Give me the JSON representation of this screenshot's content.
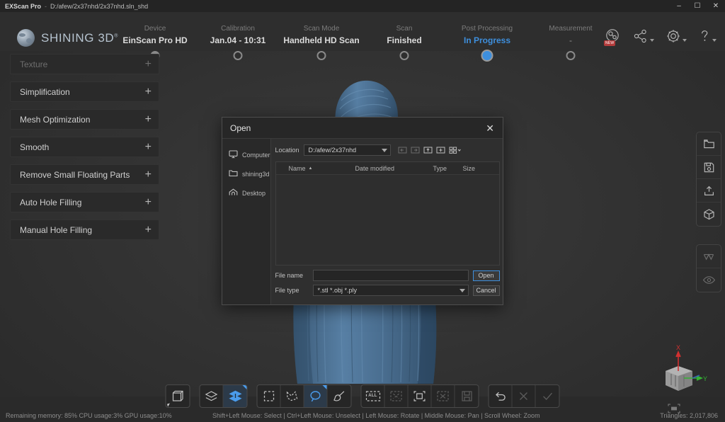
{
  "titlebar": {
    "app_name": "EXScan Pro",
    "separator": "-",
    "path": "D:/afew/2x37nhd/2x37nhd.sln_shd",
    "minimize": "–",
    "maximize": "☐",
    "close": "✕"
  },
  "brand": {
    "name": "SHINING 3D",
    "trademark": "®"
  },
  "steps": [
    {
      "caption": "Device",
      "value": "EinScan Pro HD",
      "state": "done"
    },
    {
      "caption": "Calibration",
      "value": "Jan.04 - 10:31",
      "state": "done"
    },
    {
      "caption": "Scan Mode",
      "value": "Handheld HD Scan",
      "state": "done"
    },
    {
      "caption": "Scan",
      "value": "Finished",
      "state": "done"
    },
    {
      "caption": "Post Processing",
      "value": "In Progress",
      "state": "current"
    },
    {
      "caption": "Measurement",
      "value": "-",
      "state": "pending"
    }
  ],
  "header_icons": [
    {
      "name": "model-library-icon",
      "badge": "NEW",
      "caret": false
    },
    {
      "name": "share-icon",
      "badge": "",
      "caret": true
    },
    {
      "name": "settings-gear-icon",
      "badge": "",
      "caret": true
    },
    {
      "name": "help-icon",
      "badge": "",
      "caret": true
    }
  ],
  "left_panel": [
    {
      "label": "Texture",
      "expand": "+",
      "disabled": true
    },
    {
      "label": "Simplification",
      "expand": "+",
      "disabled": false
    },
    {
      "label": "Mesh Optimization",
      "expand": "+",
      "disabled": false
    },
    {
      "label": "Smooth",
      "expand": "+",
      "disabled": false
    },
    {
      "label": "Remove Small Floating Parts",
      "expand": "+",
      "disabled": false
    },
    {
      "label": "Auto Hole Filling",
      "expand": "+",
      "disabled": false
    },
    {
      "label": "Manual Hole Filling",
      "expand": "+",
      "disabled": false
    }
  ],
  "right_tools": [
    {
      "name": "open-project-icon",
      "dim": false
    },
    {
      "name": "save-project-icon",
      "dim": false
    },
    {
      "name": "export-model-icon",
      "dim": false
    },
    {
      "name": "model-view-icon",
      "dim": false
    }
  ],
  "right_tools_2": [
    {
      "name": "wireframe-icon",
      "dim": true
    },
    {
      "name": "visibility-eye-icon",
      "dim": true
    }
  ],
  "bottom_toolbar": {
    "group1": [
      {
        "name": "bounding-box-icon",
        "state": "normal"
      }
    ],
    "group2": [
      {
        "name": "single-layer-icon",
        "state": "normal"
      },
      {
        "name": "multi-layer-icon",
        "state": "active"
      }
    ],
    "group3": [
      {
        "name": "rectangle-select-icon",
        "state": "normal"
      },
      {
        "name": "polygon-select-icon",
        "state": "normal"
      },
      {
        "name": "lasso-select-icon",
        "state": "active"
      },
      {
        "name": "brush-select-icon",
        "state": "normal"
      }
    ],
    "group4": [
      {
        "name": "select-all-icon",
        "state": "normal",
        "label": "ALL"
      },
      {
        "name": "invert-select-icon",
        "state": "dim",
        "label": ""
      },
      {
        "name": "select-visible-icon",
        "state": "normal",
        "label": ""
      },
      {
        "name": "delete-select-icon",
        "state": "dim",
        "label": ""
      },
      {
        "name": "save-select-icon",
        "state": "dim",
        "label": ""
      }
    ],
    "group5": [
      {
        "name": "undo-icon",
        "state": "normal"
      },
      {
        "name": "cancel-icon",
        "state": "dim"
      },
      {
        "name": "confirm-icon",
        "state": "dim"
      }
    ]
  },
  "gizmo": {
    "x_label": "X",
    "y_label": "Y",
    "x_color": "#d03030",
    "y_color": "#35b235"
  },
  "statusbar": {
    "resources": "Remaining memory: 85% CPU usage:3%  GPU usage:10%",
    "hints": "Shift+Left Mouse: Select | Ctrl+Left Mouse: Unselect | Left Mouse: Rotate | Middle Mouse: Pan | Scroll Wheel: Zoom",
    "triangles": "Triangles: 2,017,806"
  },
  "dialog": {
    "title": "Open",
    "close_glyph": "✕",
    "sidebar": [
      {
        "label": "Computer",
        "icon": "computer-icon"
      },
      {
        "label": "shining3d",
        "icon": "folder-icon"
      },
      {
        "label": "Desktop",
        "icon": "home-icon"
      }
    ],
    "location_label": "Location",
    "location_value": "D:/afew/2x37nhd",
    "nav_buttons": [
      {
        "name": "back-button",
        "dim": true
      },
      {
        "name": "forward-button",
        "dim": true
      },
      {
        "name": "parent-dir-button",
        "dim": false
      },
      {
        "name": "new-folder-button",
        "dim": false
      },
      {
        "name": "view-mode-button",
        "dim": false
      }
    ],
    "columns": [
      {
        "label": "Name",
        "sort": "▲"
      },
      {
        "label": "Date modified",
        "sort": ""
      },
      {
        "label": "Type",
        "sort": ""
      },
      {
        "label": "Size",
        "sort": ""
      }
    ],
    "rows": [],
    "filename_label": "File name",
    "filename_value": "",
    "filename_placeholder": "",
    "filetype_label": "File type",
    "filetype_value": "*.stl  *.obj  *.ply",
    "open_button": "Open",
    "cancel_button": "Cancel"
  },
  "colors": {
    "accent": "#3e8fdd",
    "model": "#4a6f91",
    "panel_bg": "#2a2a2a",
    "badge_red": "#b33b3b"
  }
}
